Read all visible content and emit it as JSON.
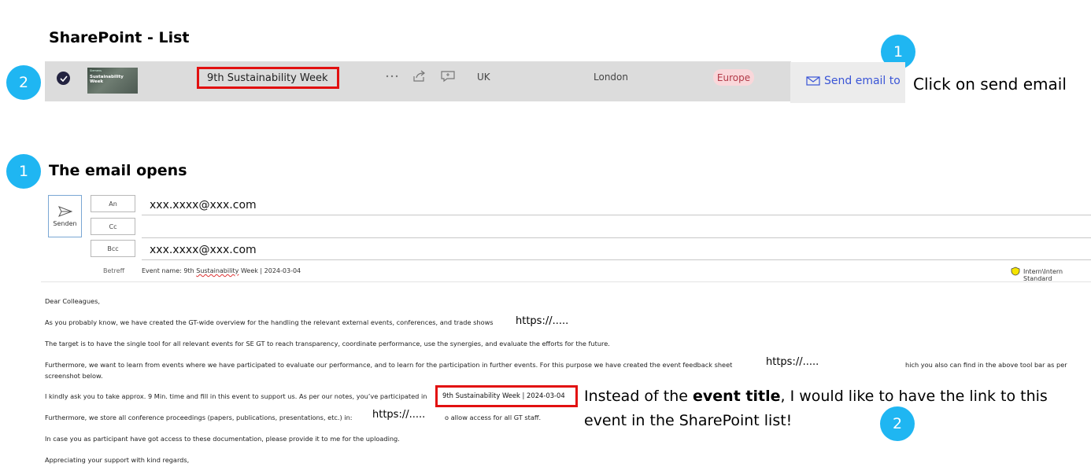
{
  "section1": {
    "title": "SharePoint - List"
  },
  "section2": {
    "title": "The email opens"
  },
  "badges": {
    "one": "1",
    "two": "2"
  },
  "list_row": {
    "thumbnail_title": "Sustainability Week",
    "thumbnail_kicker": "Siemens",
    "event_title": "9th Sustainability Week",
    "more_icon": "more-icon",
    "share_icon": "share-icon",
    "comment_icon": "comment-icon",
    "country": "UK",
    "city": "London",
    "region": "Europe",
    "send_email_label": "Send email to"
  },
  "callouts": {
    "click_send": "Click on send email",
    "instead_pre": "Instead of the ",
    "instead_bold": "event title",
    "instead_post": ", I would like to have the link to this event in the SharePoint list!"
  },
  "email": {
    "send_label": "Senden",
    "to_label": "An",
    "cc_label": "Cc",
    "bcc_label": "Bcc",
    "subject_label": "Betreff",
    "to_value": "xxx.xxxx@xxx.com",
    "cc_value": "",
    "bcc_value": "xxx.xxxx@xxx.com",
    "subject_prefix": "Event name: 9th ",
    "subject_underlined": "Sustainability",
    "subject_suffix": " Week | 2024-03-04",
    "sensitivity": "Intern\\Intern Standard",
    "colors": {
      "accent": "#1fb6f2",
      "highlight": "#e21010",
      "link": "#3a55d6"
    }
  },
  "body": {
    "greeting": "Dear Colleagues,",
    "p1": "As you probably know, we have created the GT-wide overview for the handling the relevant external events, conferences, and trade shows",
    "p1_url": "https://.....",
    "p2": "The target is to have the single tool for all relevant events for SE GT to reach transparency, coordinate performance, use the synergies, and evaluate the efforts for the future.",
    "p3a": "Furthermore, we want to learn from events where we have participated to evaluate our performance, and to learn for the participation in further events. For this purpose we have created the event feedback sheet",
    "p3_url": "https://.....",
    "p3b": "hich you also can find in the above tool bar as per",
    "p3c": "screenshot below.",
    "p4": "I kindly ask you to take approx. 9 Min. time and fill in this event to support us. As per our notes, you’ve participated in",
    "p4_event": "9th Sustainability Week | 2024-03-04",
    "p5a": "Furthermore, we store all conference proceedings (papers, publications, presentations, etc.) in:",
    "p5_url": "https://.....",
    "p5b": "o allow access for all GT staff.",
    "p6": "In case you as participant have got access to these documentation, please provide it to me for the uploading.",
    "p7": "Appreciating your support with kind regards,"
  }
}
